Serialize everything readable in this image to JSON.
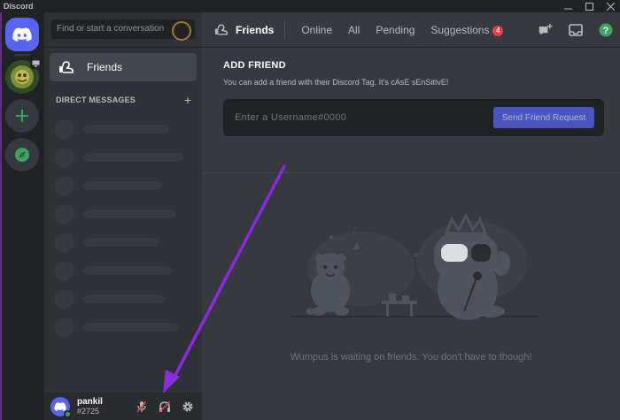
{
  "window": {
    "app_name": "Discord",
    "buttons": [
      "minimize",
      "maximize",
      "close"
    ]
  },
  "guilds": {
    "home_icon": "discord-logo-icon",
    "add_icon": "plus-icon",
    "explore_icon": "compass-icon"
  },
  "sidebar": {
    "search_placeholder": "Find or start a conversation",
    "friends_label": "Friends",
    "dm_header": "DIRECT MESSAGES",
    "dm_add": "+"
  },
  "user": {
    "name": "pankil",
    "tag": "#2725",
    "status_color": "#3ba55d"
  },
  "topbar": {
    "title": "Friends",
    "tabs": [
      "Online",
      "All",
      "Pending",
      "Suggestions"
    ],
    "suggestions_badge": "4"
  },
  "add_friend": {
    "title": "ADD FRIEND",
    "description": "You can add a friend with their Discord Tag. It's cAsE sEnSitIvE!",
    "input_placeholder": "Enter a Username#0000",
    "button_label": "Send Friend Request"
  },
  "empty_state": {
    "message": "Wumpus is waiting on friends. You don't have to though!"
  },
  "colors": {
    "accent": "#5865f2",
    "danger": "#ed4245",
    "online": "#3ba55d",
    "annotation_arrow": "#8a2be2"
  }
}
